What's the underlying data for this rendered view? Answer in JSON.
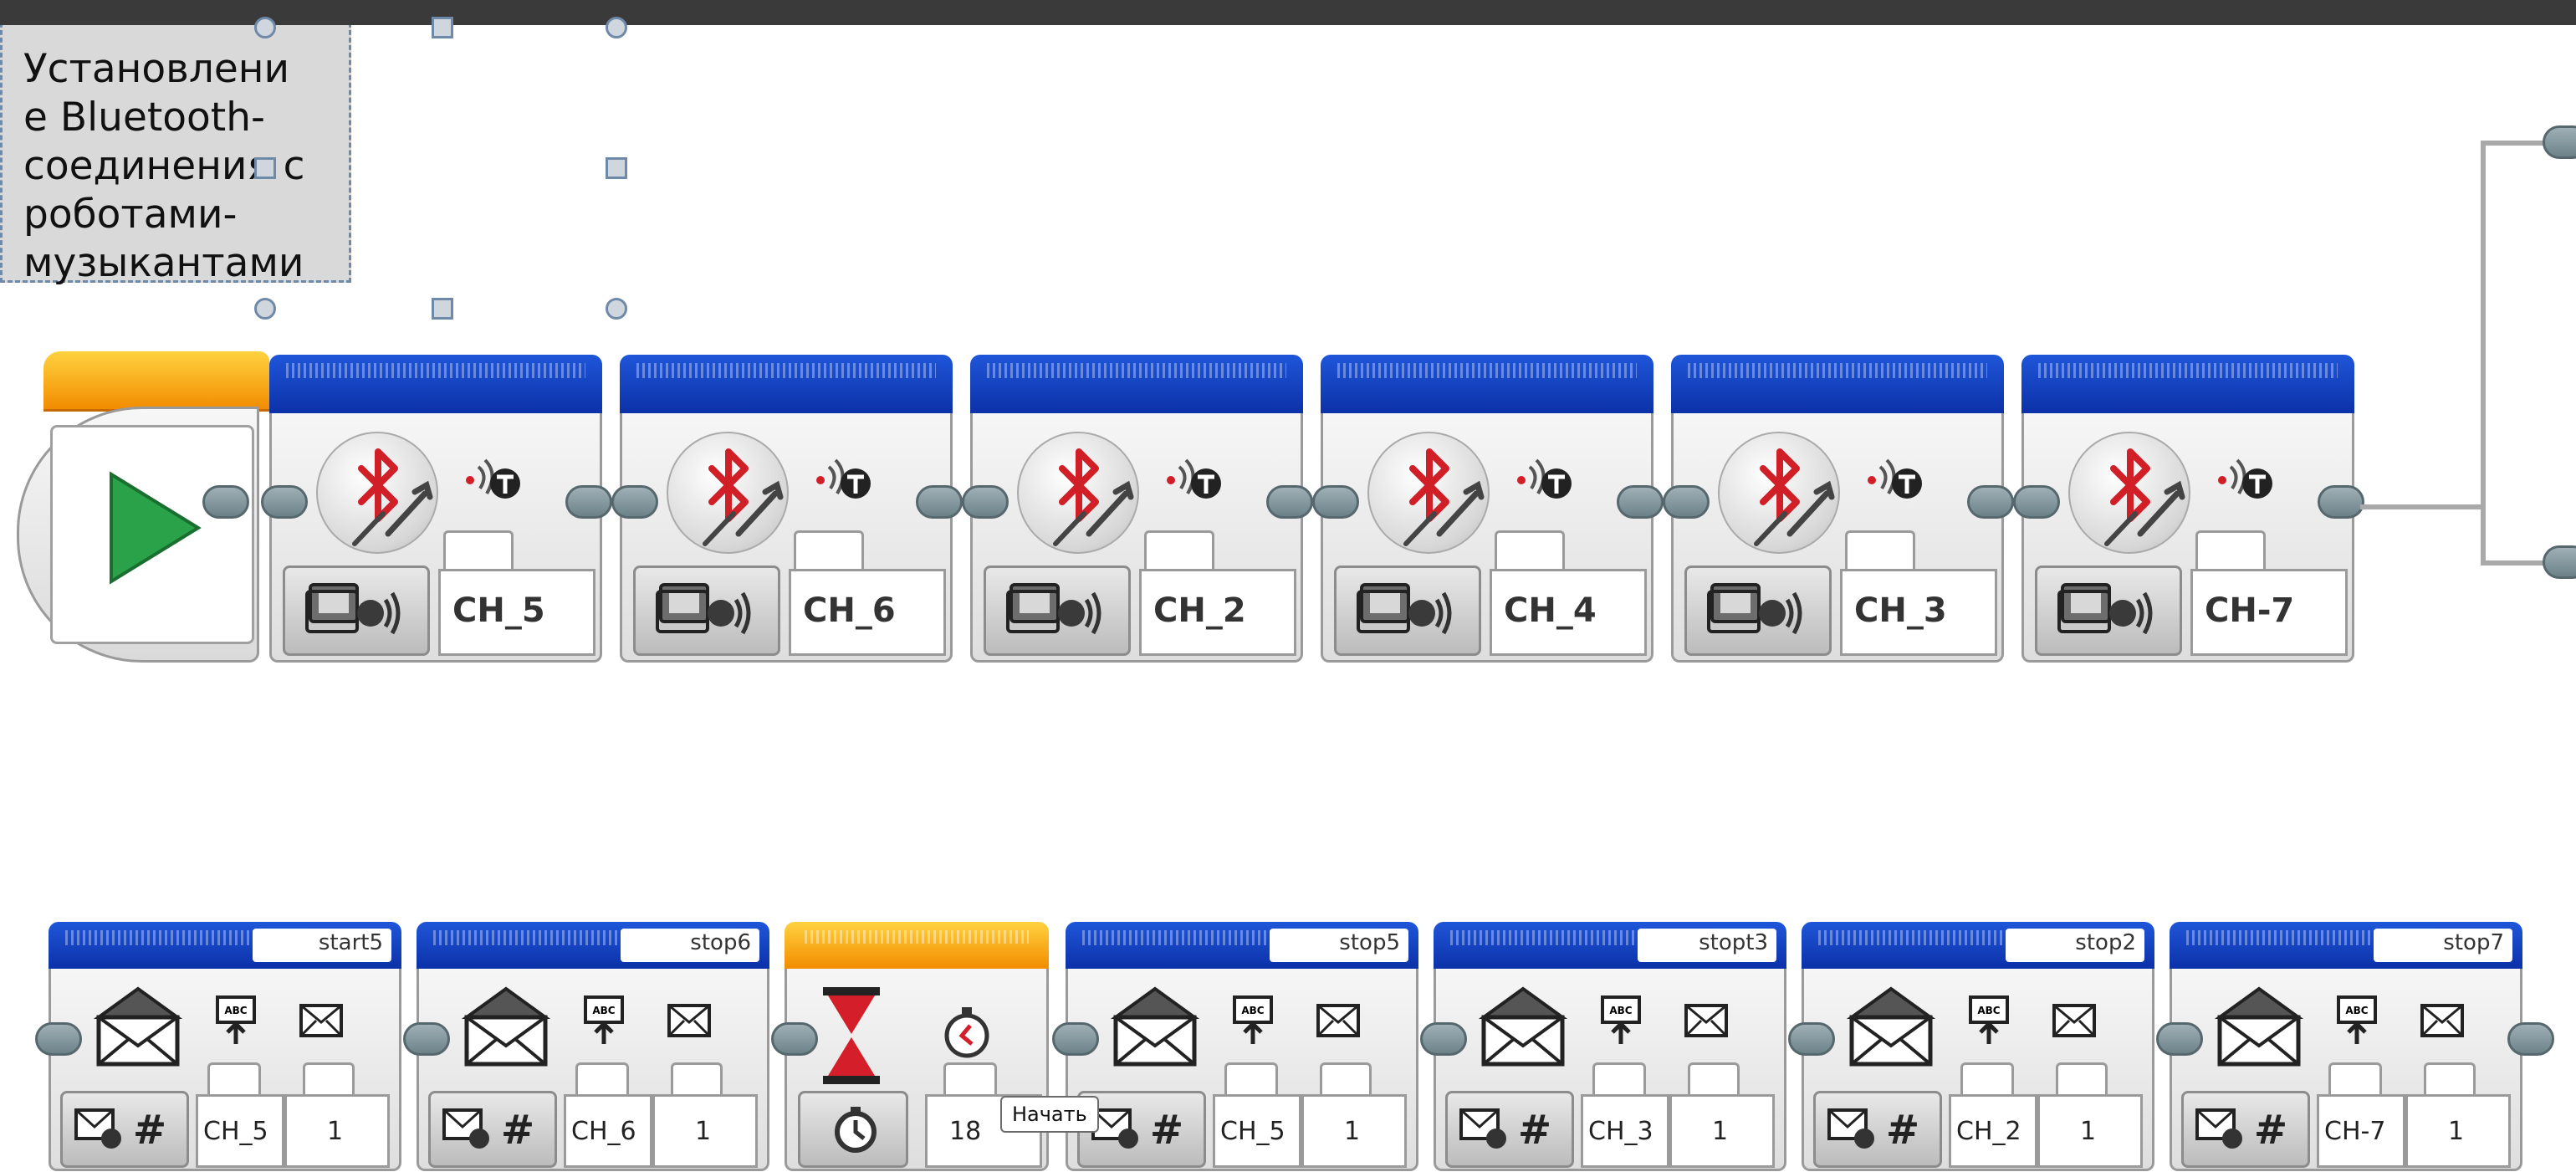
{
  "comment": {
    "text": "Установлени\nе Bluetooth-\nсоединения с\nроботами-\nмузыкантами"
  },
  "colors": {
    "bluetooth": "#d11f27",
    "start_arrow": "#2aa24a",
    "wire": "#a9a9a9",
    "block_header_blue": "#0c31a8",
    "block_header_orange": "#f28c00"
  },
  "row1": {
    "start_block": {
      "icon": "play-icon"
    },
    "bluetooth_blocks": [
      {
        "name": "CH_5"
      },
      {
        "name": "CH_6"
      },
      {
        "name": "CH_2"
      },
      {
        "name": "CH_4"
      },
      {
        "name": "CH_3"
      },
      {
        "name": "CH-7"
      }
    ]
  },
  "row2": {
    "message_blocks_before": [
      {
        "title": "start5",
        "receiver": "CH_5",
        "value": "1"
      },
      {
        "title": "stop6",
        "receiver": "CH_6",
        "value": "1"
      }
    ],
    "wait_block": {
      "value": "18",
      "tooltip": "Начать"
    },
    "message_blocks_after": [
      {
        "title": "stop5",
        "receiver": "CH_5",
        "value": "1"
      },
      {
        "title": "stopt3",
        "receiver": "CH_3",
        "value": "1"
      },
      {
        "title": "stop2",
        "receiver": "CH_2",
        "value": "1"
      },
      {
        "title": "stop7",
        "receiver": "CH-7",
        "value": "1"
      }
    ]
  }
}
